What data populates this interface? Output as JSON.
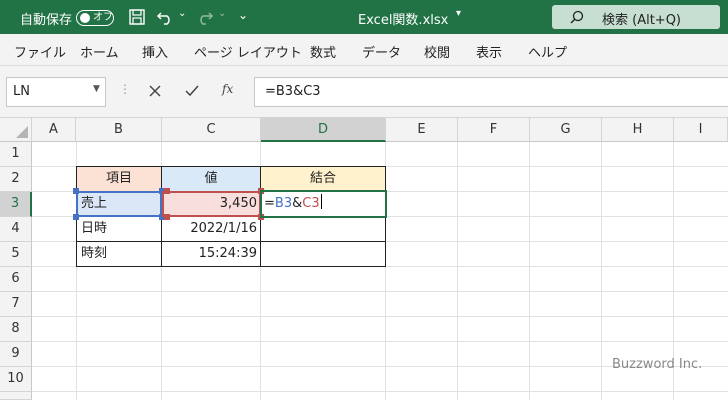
{
  "titlebar": {
    "autosave_label": "自動保存",
    "autosave_state": "オフ",
    "filename": "Excel関数.xlsx",
    "search_placeholder": "検索 (Alt+Q)"
  },
  "ribbon_tabs": [
    "ファイル",
    "ホーム",
    "挿入",
    "ページ レイアウト",
    "数式",
    "データ",
    "校閲",
    "表示",
    "ヘルプ"
  ],
  "formula_bar": {
    "name_box": "LN",
    "fx": "fx",
    "formula": "=B3&C3"
  },
  "columns": [
    "A",
    "B",
    "C",
    "D",
    "E",
    "F",
    "G",
    "H",
    "I"
  ],
  "rows": [
    "1",
    "2",
    "3",
    "4",
    "5",
    "6",
    "7",
    "8",
    "9",
    "10"
  ],
  "table": {
    "headers": [
      "項目",
      "値",
      "結合"
    ],
    "rows": [
      [
        "売上",
        "3,450"
      ],
      [
        "日時",
        "2022/1/16",
        ""
      ],
      [
        "時刻",
        "15:24:39",
        ""
      ]
    ],
    "editing": {
      "part1": "=",
      "ref1": "B3",
      "amp": "&",
      "ref2": "C3"
    }
  },
  "colors": {
    "brand": "#217346",
    "header_b": "#fbe2d5",
    "header_c": "#dae9f8",
    "header_d": "#fff2cc",
    "ref1": "#4472c4",
    "ref2": "#c0504d"
  },
  "watermark": "Buzzword Inc."
}
